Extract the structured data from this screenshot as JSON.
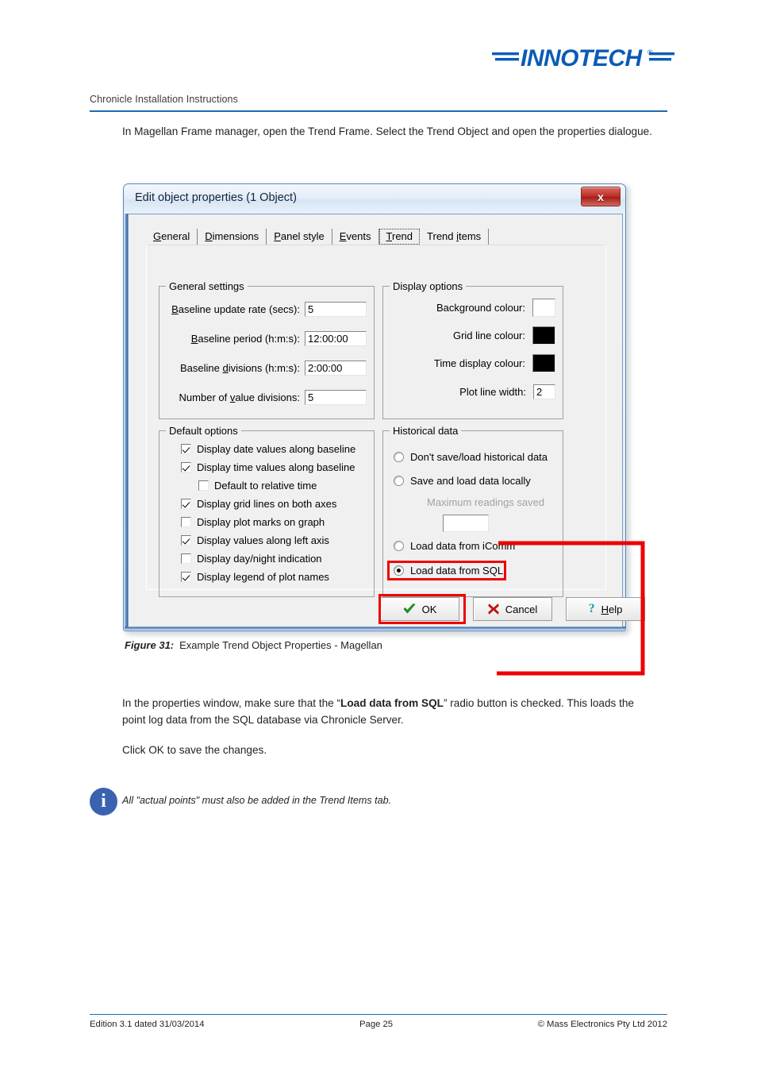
{
  "header": {
    "doc_title": "Chronicle Installation Instructions",
    "logo_text": "INNOTECH",
    "logo_mark": "®"
  },
  "intro_paragraph": "In Magellan Frame manager, open the Trend Frame. Select the Trend Object and open the properties dialogue.",
  "dialog": {
    "title": "Edit object properties (1 Object)",
    "close_icon": "close-icon",
    "close_label": "x",
    "tabs": [
      {
        "label": "General",
        "accel": "G",
        "selected": false
      },
      {
        "label": "Dimensions",
        "accel": "D",
        "selected": false
      },
      {
        "label": "Panel style",
        "accel": "P",
        "selected": false
      },
      {
        "label": "Events",
        "accel": "E",
        "selected": false
      },
      {
        "label": "Trend",
        "accel": "T",
        "selected": true
      },
      {
        "label": "Trend items",
        "accel": "i",
        "selected": false
      }
    ],
    "general_settings": {
      "legend": "General settings",
      "fields": [
        {
          "label": "Baseline update rate (secs):",
          "accel": "B",
          "value": "5"
        },
        {
          "label": "Baseline period (h:m:s):",
          "accel": "B",
          "value": "12:00:00"
        },
        {
          "label": "Baseline divisions (h:m:s):",
          "accel": "d",
          "value": "2:00:00"
        },
        {
          "label": "Number of value divisions:",
          "accel": "v",
          "value": "5"
        }
      ]
    },
    "display_options": {
      "legend": "Display options",
      "rows": [
        {
          "label": "Background colour:",
          "type": "swatch",
          "color": "#ffffff"
        },
        {
          "label": "Grid line colour:",
          "type": "swatch",
          "color": "#000000"
        },
        {
          "label": "Time display colour:",
          "type": "swatch",
          "color": "#000000"
        },
        {
          "label": "Plot line width:",
          "type": "text",
          "value": "2"
        }
      ]
    },
    "default_options": {
      "legend": "Default options",
      "items": [
        {
          "label": "Display date values along baseline",
          "checked": true,
          "indent": false
        },
        {
          "label": "Display time values along baseline",
          "checked": true,
          "indent": false
        },
        {
          "label": "Default to relative time",
          "checked": false,
          "indent": true
        },
        {
          "label": "Display grid lines on both axes",
          "checked": true,
          "indent": false
        },
        {
          "label": "Display plot marks on graph",
          "checked": false,
          "indent": false
        },
        {
          "label": "Display values along left axis",
          "checked": true,
          "indent": false
        },
        {
          "label": "Display day/night indication",
          "checked": false,
          "indent": false
        },
        {
          "label": "Display legend of plot names",
          "checked": true,
          "indent": false
        }
      ]
    },
    "historical_data": {
      "legend": "Historical data",
      "options": [
        {
          "label": "Don't save/load historical data",
          "selected": false
        },
        {
          "label": "Save and load data locally",
          "selected": false
        },
        {
          "label": "Load data from iComm",
          "selected": false
        },
        {
          "label": "Load data from SQL",
          "selected": true
        }
      ],
      "max_readings_label": "Maximum readings saved",
      "max_readings_value": "",
      "max_readings_disabled": true
    },
    "buttons": [
      {
        "name": "ok",
        "label": "OK",
        "icon": "check-icon",
        "accel": ""
      },
      {
        "name": "cancel",
        "label": "Cancel",
        "icon": "cross-icon",
        "accel": ""
      },
      {
        "name": "help",
        "label": "Help",
        "icon": "question-icon",
        "accel": "H"
      }
    ]
  },
  "figure": {
    "label": "Figure 31:",
    "caption": "Example Trend Object Properties - Magellan"
  },
  "paragraphs": {
    "p1_before": "In the properties window, make sure that the “",
    "p1_bold": "Load data from SQL",
    "p1_after": "” radio button is checked. This loads the point log data from the SQL database via Chronicle Server.",
    "p2": "Click OK to save the changes."
  },
  "note": {
    "icon": "info-icon",
    "glyph": "i",
    "text": "All \"actual points\" must also be added in the Trend Items tab."
  },
  "footer": {
    "left": "Edition 3.1 dated 31/03/2014",
    "center": "Page 25",
    "right": "©  Mass Electronics Pty Ltd  2012"
  },
  "colors": {
    "brand_blue": "#0b5bb5",
    "rule_blue": "#1c6bb0",
    "annotation_red": "#ef0000",
    "note_blue": "#3b62b0"
  }
}
